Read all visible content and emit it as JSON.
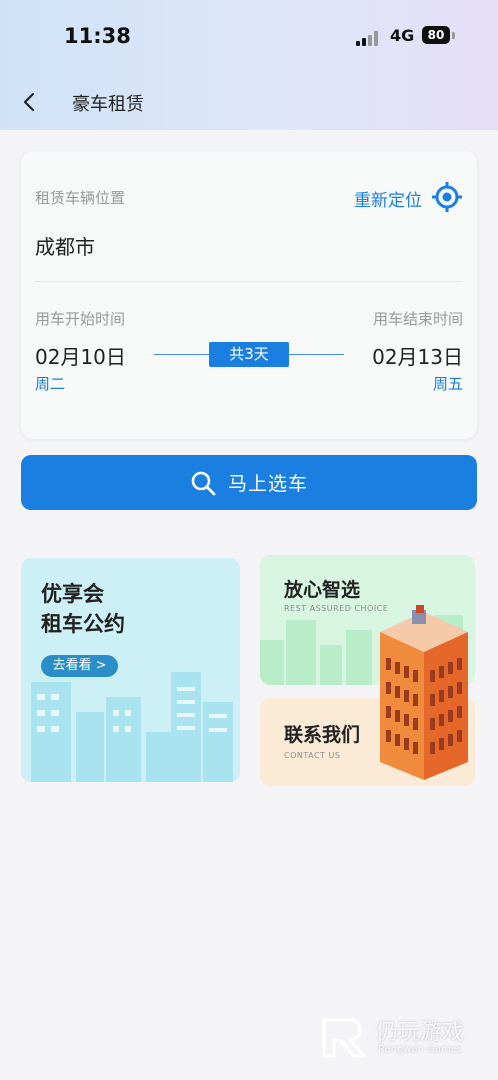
{
  "status": {
    "time": "11:38",
    "network": "4G",
    "battery": "80"
  },
  "nav": {
    "title": "豪车租赁"
  },
  "location": {
    "label": "租赁车辆位置",
    "relocate": "重新定位",
    "city": "成都市"
  },
  "rental": {
    "start_label": "用车开始时间",
    "end_label": "用车结束时间",
    "start_date": "02月10日",
    "start_weekday": "周二",
    "end_date": "02月13日",
    "end_weekday": "周五",
    "duration": "共3天"
  },
  "search_button": "马上选车",
  "promos": {
    "left": {
      "line1": "优享会",
      "line2": "租车公约",
      "button": "去看看 >"
    },
    "top_right": {
      "title": "放心智选",
      "subtitle": "REST ASSURED CHOICE"
    },
    "bottom_right": {
      "title": "联系我们",
      "subtitle": "CONTACT US"
    }
  },
  "watermark": {
    "cn": "仍玩游戏",
    "en": "Rengwan Games"
  },
  "colors": {
    "accent": "#1a7fe0",
    "header_gradient": [
      "#cfe3f7",
      "#e4def7"
    ]
  }
}
